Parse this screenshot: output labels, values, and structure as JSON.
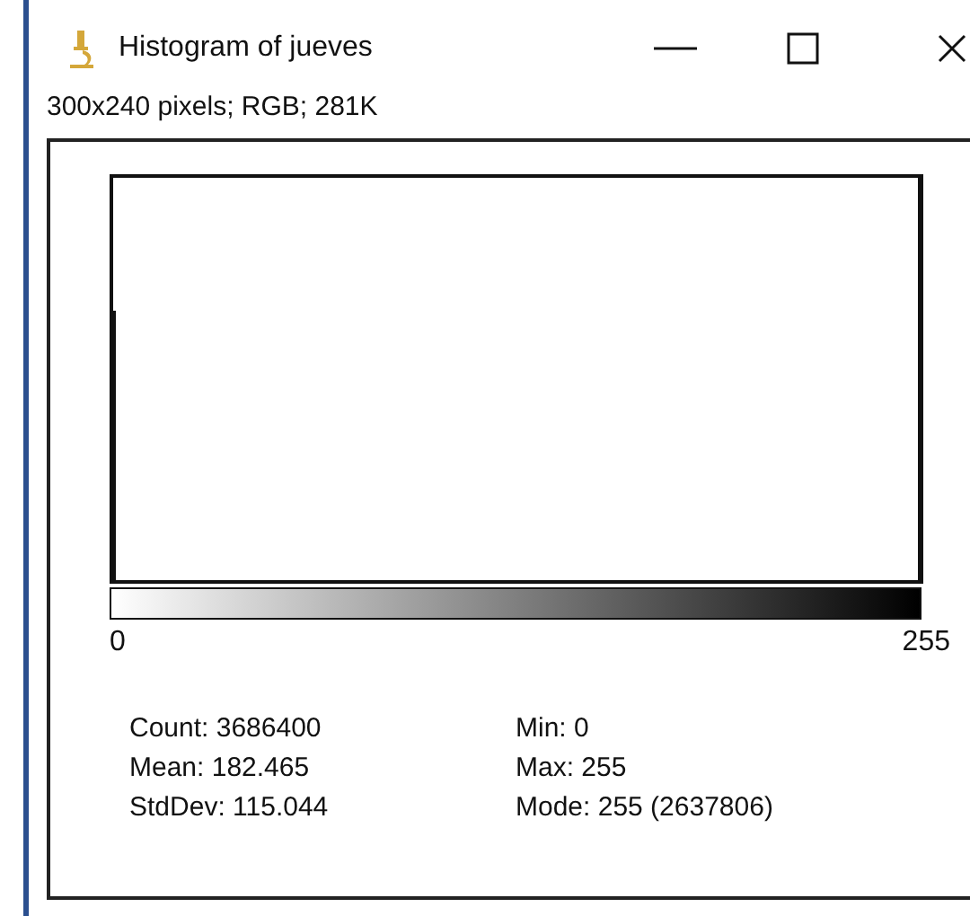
{
  "window": {
    "title": "Histogram of jueves"
  },
  "image_info": "300x240 pixels; RGB; 281K",
  "histogram": {
    "axis_min": "0",
    "axis_max": "255"
  },
  "stats": [
    {
      "label": "Count: 3686400"
    },
    {
      "label": "Min: 0"
    },
    {
      "label": "Mean: 182.465"
    },
    {
      "label": "Max: 255"
    },
    {
      "label": "StdDev: 115.044"
    },
    {
      "label": "Mode: 255 (2637806)"
    }
  ]
}
